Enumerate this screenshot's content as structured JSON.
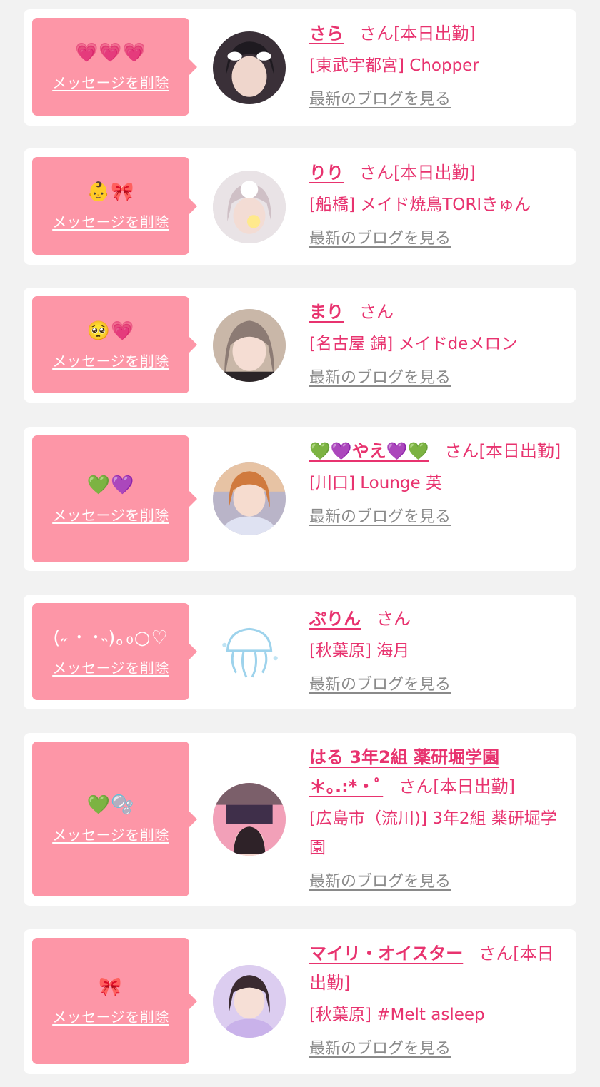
{
  "common": {
    "delete_label": "メッセージを削除",
    "blog_label": "最新のブログを見る",
    "accent_color": "#e8336f",
    "bubble_color": "#fd96a7"
  },
  "favorites": [
    {
      "message": "💗💗💗",
      "name": "さら",
      "suffix": "さん[本日出勤]",
      "shop": "[東武宇都宮] Chopper"
    },
    {
      "message": "👶🎀",
      "name": "りり",
      "suffix": "さん[本日出勤]",
      "shop": "[船橋] メイド焼鳥TORIきゅん"
    },
    {
      "message": "🥺💗",
      "name": "まり",
      "suffix": "さん",
      "shop": "[名古屋 錦] メイドdeメロン"
    },
    {
      "message": "💚💜",
      "name": "💚💜やえ💜💚",
      "suffix": "さん[本日出勤]",
      "shop": "[川口] Lounge 英"
    },
    {
      "message": "(˶ ･ ･˵)｡₀○♡",
      "name": "ぷりん",
      "suffix": "さん",
      "shop": "[秋葉原] 海月"
    },
    {
      "message": "💚🫧",
      "name": "はる 3年2組 薬研堀学園 ＊｡.:*・ﾟ",
      "suffix": "さん[本日出勤]",
      "shop": "[広島市（流川)] 3年2組 薬研堀学園"
    },
    {
      "message": "🎀",
      "name": "マイリ・オイスター",
      "suffix": "さん[本日出勤]",
      "shop": "[秋葉原] #Melt asleep"
    }
  ]
}
